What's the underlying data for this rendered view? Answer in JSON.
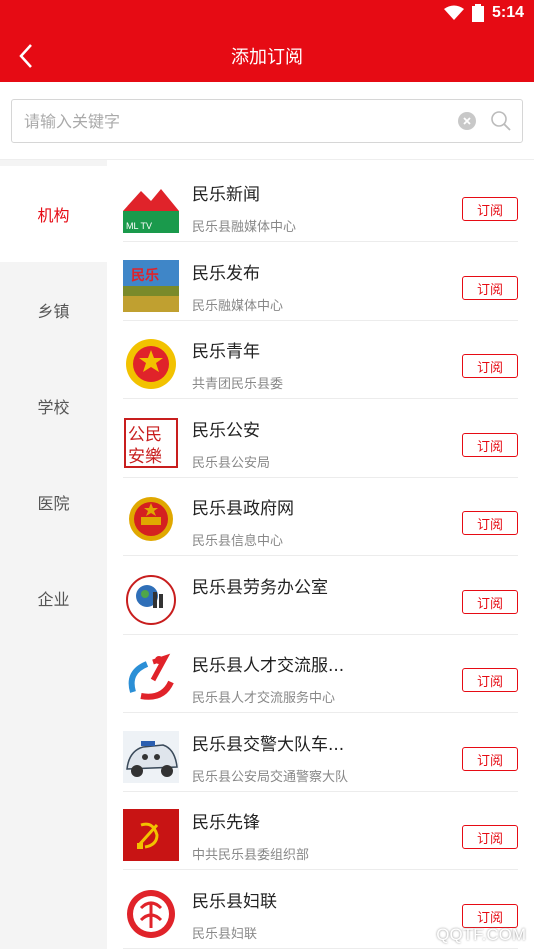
{
  "status": {
    "time": "5:14"
  },
  "app_bar": {
    "title": "添加订阅"
  },
  "search": {
    "placeholder": "请输入关键字"
  },
  "categories": [
    {
      "label": "机构",
      "active": true
    },
    {
      "label": "乡镇"
    },
    {
      "label": "学校"
    },
    {
      "label": "医院"
    },
    {
      "label": "企业"
    }
  ],
  "subscribe_label": "订阅",
  "items": [
    {
      "name": "民乐新闻",
      "desc": "民乐县融媒体中心",
      "logo": "mountain-tv-logo",
      "logo_text": "ML TV"
    },
    {
      "name": "民乐发布",
      "desc": "民乐融媒体中心",
      "logo": "landscape-logo",
      "logo_text": "民乐"
    },
    {
      "name": "民乐青年",
      "desc": "共青团民乐县委",
      "logo": "youth-league-logo"
    },
    {
      "name": "民乐公安",
      "desc": "民乐县公安局",
      "logo": "police-seal-logo",
      "logo_text": "公民安樂"
    },
    {
      "name": "民乐县政府网",
      "desc": "民乐县信息中心",
      "logo": "national-emblem-logo"
    },
    {
      "name": "民乐县劳务办公室",
      "desc": "",
      "logo": "labor-office-logo"
    },
    {
      "name": "民乐县人才交流服...",
      "desc": "民乐县人才交流服务中心",
      "logo": "talent-logo"
    },
    {
      "name": "民乐县交警大队车...",
      "desc": "民乐县公安局交通警察大队",
      "logo": "police-car-logo"
    },
    {
      "name": "民乐先锋",
      "desc": "中共民乐县委组织部",
      "logo": "party-emblem-logo"
    },
    {
      "name": "民乐县妇联",
      "desc": "民乐县妇联",
      "logo": "womens-federation-logo"
    }
  ],
  "watermark": "QQTF.COM",
  "colors": {
    "primary": "#e60b14",
    "sidebar_bg": "#f4f4f4"
  }
}
